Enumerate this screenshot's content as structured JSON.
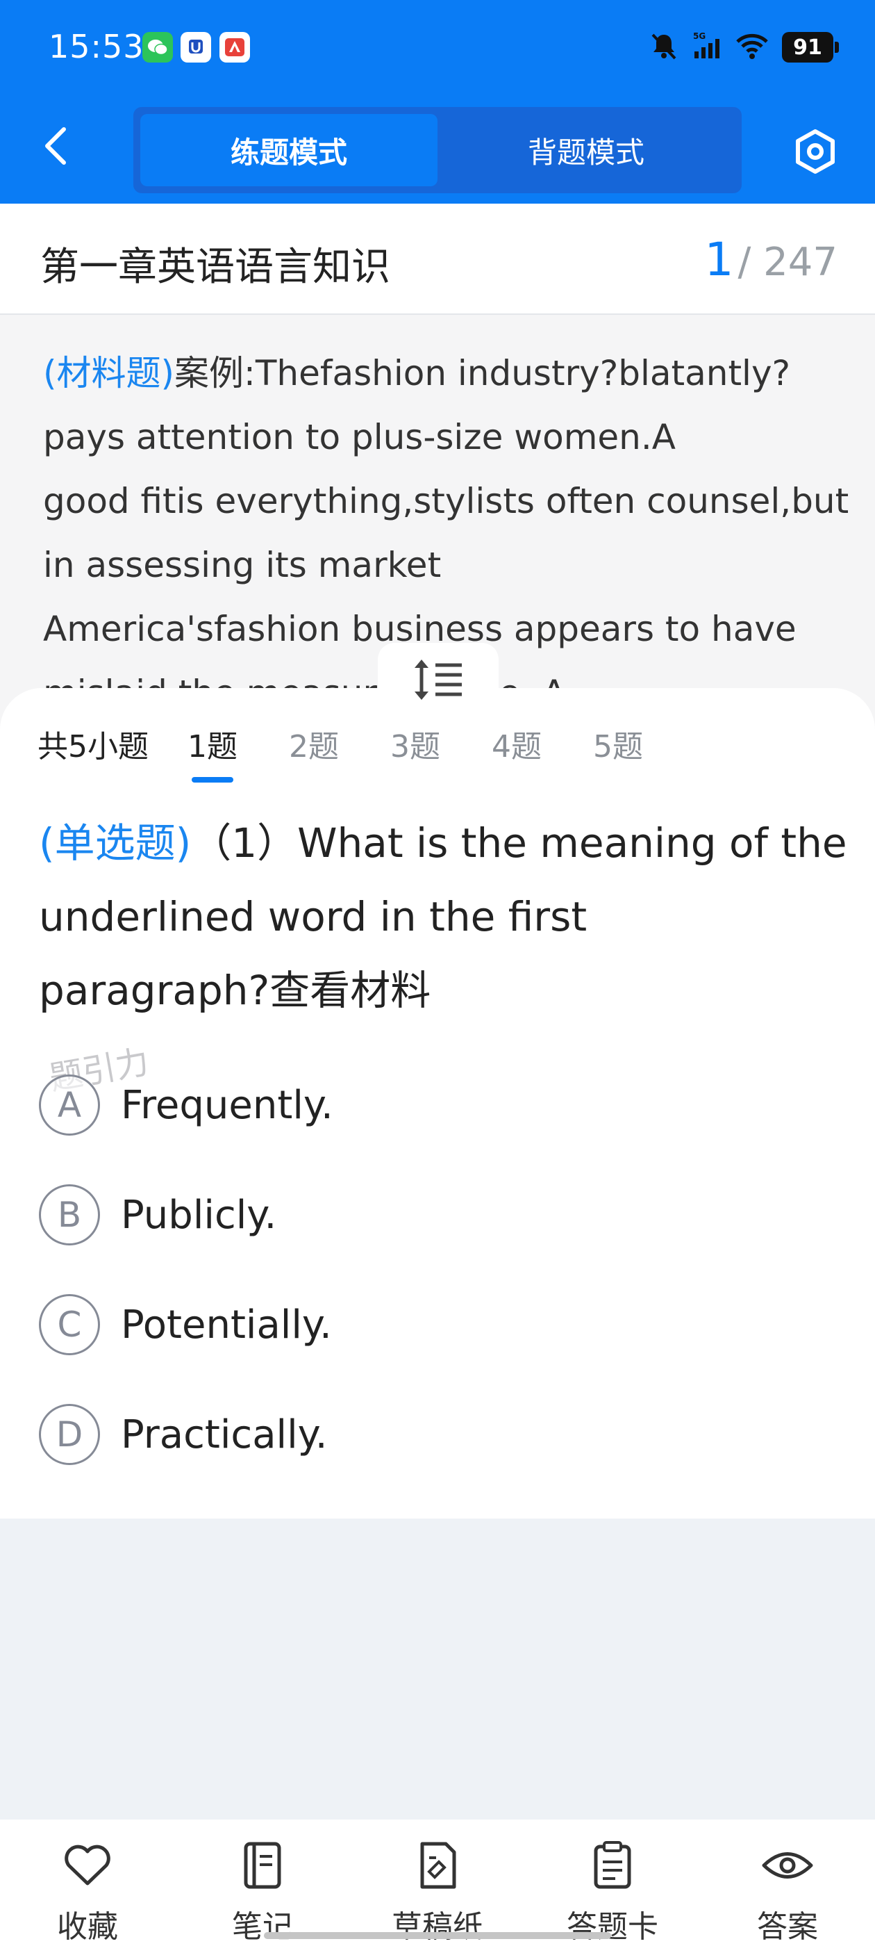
{
  "status_bar": {
    "time": "15:53",
    "network": "5G",
    "battery": "91"
  },
  "header": {
    "mode_tabs": [
      {
        "label": "练题模式",
        "active": true
      },
      {
        "label": "背题模式",
        "active": false
      }
    ]
  },
  "chapter": {
    "title": "第一章英语语言知识",
    "current": "1",
    "total": "/ 247"
  },
  "material": {
    "tag": "(材料题)",
    "lines": [
      "案例:Thefashion industry?blatantly?",
      "pays attention to plus-size women.A",
      "good fitis everything,stylists often counsel,but",
      "in assessing its market",
      "America'sfashion business appears to have",
      "mislaid the measuring tape. A"
    ]
  },
  "sub_questions": {
    "count_label": "共5小题",
    "tabs": [
      "1题",
      "2题",
      "3题",
      "4题",
      "5题"
    ],
    "active_index": 0
  },
  "question": {
    "tag": "(单选题)",
    "line1": "（1）What is the meaning of the",
    "line2": "underlined word in the first",
    "line3": "paragraph?查看材料"
  },
  "watermark": "题引力",
  "options": [
    {
      "letter": "A",
      "text": "Frequently."
    },
    {
      "letter": "B",
      "text": "Publicly."
    },
    {
      "letter": "C",
      "text": "Potentially."
    },
    {
      "letter": "D",
      "text": "Practically."
    }
  ],
  "toolbar": [
    {
      "label": "收藏",
      "icon": "heart-icon"
    },
    {
      "label": "笔记",
      "icon": "notebook-icon"
    },
    {
      "label": "草稿纸",
      "icon": "draft-paper-icon"
    },
    {
      "label": "答题卡",
      "icon": "answer-card-icon"
    },
    {
      "label": "答案",
      "icon": "eye-icon"
    }
  ],
  "colors": {
    "primary": "#0a7cf5",
    "tag": "#1a86f0"
  }
}
